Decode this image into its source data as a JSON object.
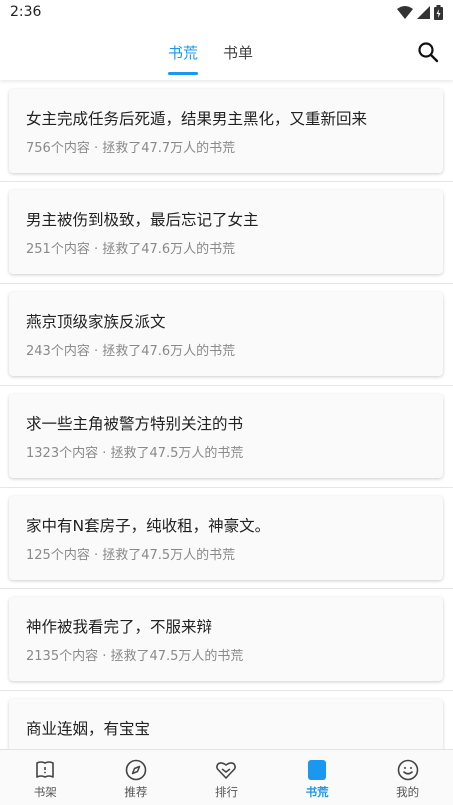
{
  "status_bar": {
    "time": "2:36"
  },
  "header": {
    "tabs": [
      {
        "label": "书荒",
        "active": true
      },
      {
        "label": "书单",
        "active": false
      }
    ],
    "search_icon": "search-icon"
  },
  "colors": {
    "accent": "#1a98f0"
  },
  "cards": [
    {
      "title": "女主完成任务后死遁，结果男主黑化，又重新回来",
      "meta": "756个内容 · 拯救了47.7万人的书荒"
    },
    {
      "title": "男主被伤到极致，最后忘记了女主",
      "meta": "251个内容 · 拯救了47.6万人的书荒"
    },
    {
      "title": "燕京顶级家族反派文",
      "meta": "243个内容 · 拯救了47.6万人的书荒"
    },
    {
      "title": "求一些主角被警方特别关注的书",
      "meta": "1323个内容 · 拯救了47.5万人的书荒"
    },
    {
      "title": "家中有N套房子，纯收租，神豪文。",
      "meta": "125个内容 · 拯救了47.5万人的书荒"
    },
    {
      "title": "神作被我看完了，不服来辩",
      "meta": "2135个内容 · 拯救了47.5万人的书荒"
    },
    {
      "title": "商业连姻，有宝宝",
      "meta": ""
    }
  ],
  "bottom_nav": [
    {
      "label": "书架",
      "icon": "bookshelf-icon",
      "active": false
    },
    {
      "label": "推荐",
      "icon": "compass-icon",
      "active": false
    },
    {
      "label": "排行",
      "icon": "ranking-icon",
      "active": false
    },
    {
      "label": "书荒",
      "icon": "book-shortage-icon",
      "active": true
    },
    {
      "label": "我的",
      "icon": "profile-icon",
      "active": false
    }
  ]
}
